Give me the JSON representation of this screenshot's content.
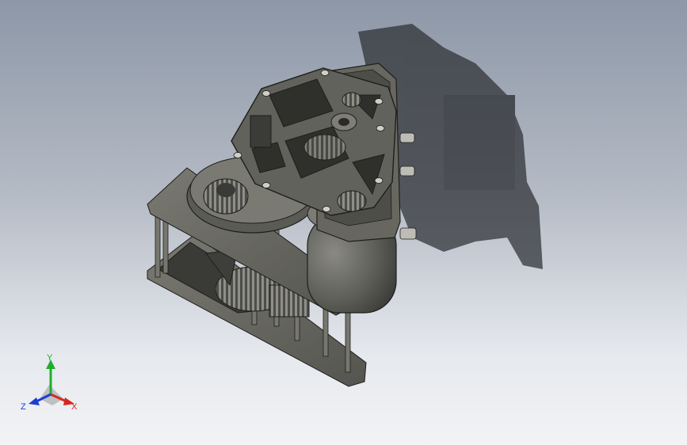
{
  "viewport": {
    "background_top": "#8d97a7",
    "background_bottom": "#f2f3f5"
  },
  "model": {
    "body_color": "#6b6b66",
    "edge_color": "#1e1e1c",
    "shadow_color": "#2d2f33"
  },
  "triad": {
    "y_label": "Y",
    "x_label": "X",
    "z_label": "Z",
    "y_color": "#1fae2b",
    "x_color": "#d42a1f",
    "z_color": "#1c3fd1"
  }
}
